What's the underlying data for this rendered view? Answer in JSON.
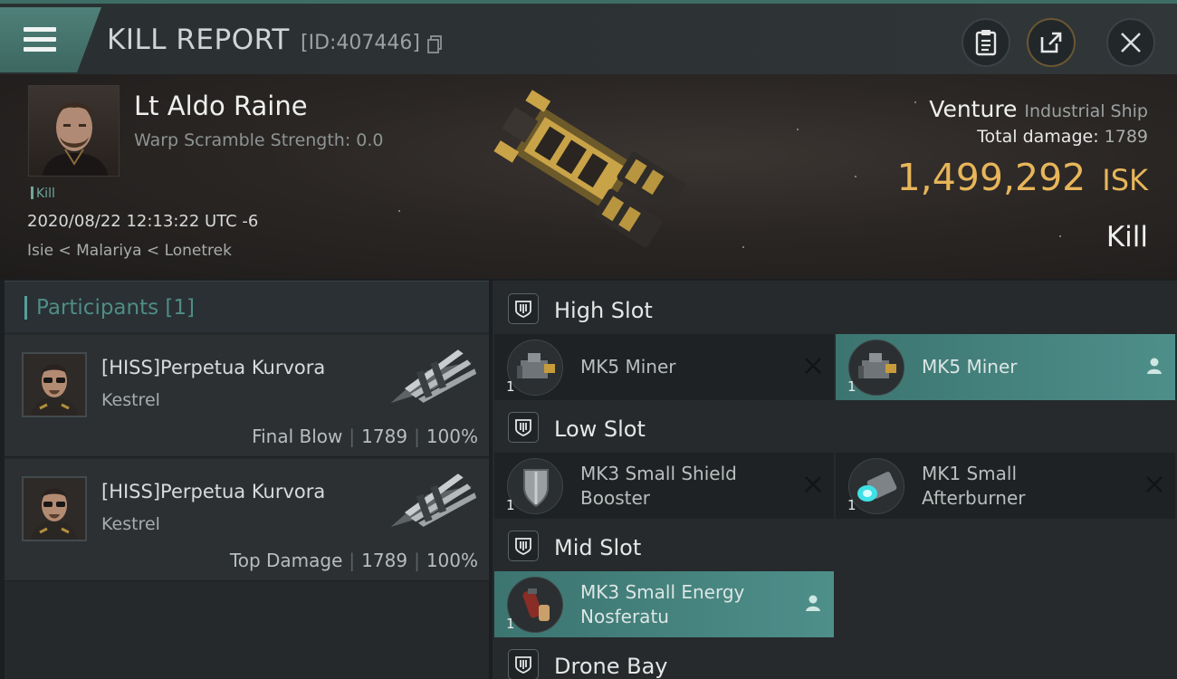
{
  "header": {
    "title": "KILL REPORT",
    "report_id": "[ID:407446]"
  },
  "victim": {
    "name": "Lt Aldo Raine",
    "warp_scramble": "Warp Scramble Strength: 0.0",
    "tag": "Kill",
    "datetime": "2020/08/22 12:13:22 UTC -6",
    "location": "Isie < Malariya < Lonetrek",
    "ship_name": "Venture",
    "ship_class": "Industrial Ship",
    "total_damage_label": "Total damage:",
    "total_damage": "1789",
    "isk_value": "1,499,292",
    "isk_unit": "ISK",
    "result": "Kill"
  },
  "participants": {
    "label": "Participants",
    "count": "[1]",
    "rows": [
      {
        "name": "[HISS]Perpetua Kurvora",
        "ship": "Kestrel",
        "role": "Final Blow",
        "damage": "1789",
        "percent": "100%"
      },
      {
        "name": "[HISS]Perpetua Kurvora",
        "ship": "Kestrel",
        "role": "Top Damage",
        "damage": "1789",
        "percent": "100%"
      }
    ]
  },
  "slots": {
    "high": {
      "label": "High Slot",
      "items": [
        {
          "name_1": "MK5 Miner",
          "name_2": "",
          "qty": "1",
          "status": "destroyed"
        },
        {
          "name_1": "MK5 Miner",
          "name_2": "",
          "qty": "1",
          "status": "dropped"
        }
      ]
    },
    "low": {
      "label": "Low Slot",
      "items": [
        {
          "name_1": "MK3 Small Shield",
          "name_2": "Booster",
          "qty": "1",
          "status": "destroyed"
        },
        {
          "name_1": "MK1 Small",
          "name_2": "Afterburner",
          "qty": "1",
          "status": "destroyed"
        }
      ]
    },
    "mid": {
      "label": "Mid Slot",
      "items": [
        {
          "name_1": "MK3 Small Energy",
          "name_2": "Nosferatu",
          "qty": "1",
          "status": "dropped"
        }
      ]
    },
    "drone": {
      "label": "Drone Bay"
    }
  },
  "colors": {
    "accent_teal": "#4e8f8a",
    "isk_gold": "#e7b55a",
    "header_tab": "#4f8079"
  },
  "icons": [
    "menu-icon",
    "copy-icon",
    "clipboard-icon",
    "share-icon",
    "close-icon",
    "slot-icon",
    "destroyed-x-icon",
    "dropped-person-icon"
  ]
}
